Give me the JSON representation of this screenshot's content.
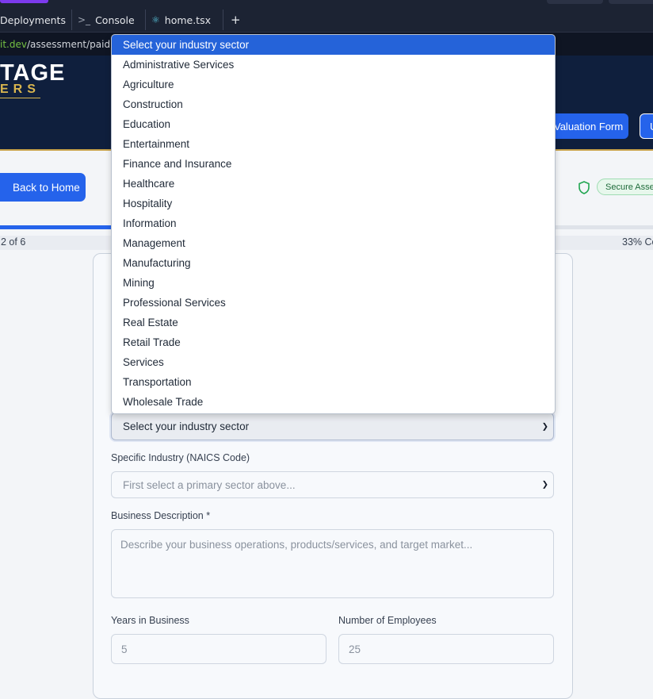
{
  "ide": {
    "tabs": [
      {
        "label": "Deployments"
      },
      {
        "glyph": ">_",
        "label": "Console"
      },
      {
        "glyph": "⚛",
        "label": "home.tsx"
      }
    ],
    "new_tab": "+",
    "url_domain": "it.dev",
    "url_path": "/assessment/paid"
  },
  "header": {
    "logo_line1": "TAGE",
    "logo_line2": "ERS",
    "valuation_button": "Valuation Form",
    "outline_button": "U"
  },
  "subheader": {
    "back_button": "Back to Home",
    "secure_badge": "Secure Assessment"
  },
  "progress": {
    "step_text": "2 of 6",
    "percent_text": "33% Co",
    "percent_value": 0.33
  },
  "form": {
    "industry_select": {
      "value": "Select your industry sector",
      "options": [
        "Select your industry sector",
        "Administrative Services",
        "Agriculture",
        "Construction",
        "Education",
        "Entertainment",
        "Finance and Insurance",
        "Healthcare",
        "Hospitality",
        "Information",
        "Management",
        "Manufacturing",
        "Mining",
        "Professional Services",
        "Real Estate",
        "Retail Trade",
        "Services",
        "Transportation",
        "Wholesale Trade"
      ]
    },
    "naics_label": "Specific Industry (NAICS Code)",
    "naics_placeholder": "First select a primary sector above...",
    "description_label": "Business Description *",
    "description_placeholder": "Describe your business operations, products/services, and target market...",
    "years_label": "Years in Business",
    "years_placeholder": "5",
    "employees_label": "Number of Employees",
    "employees_placeholder": "25"
  },
  "colors": {
    "primary": "#2563eb",
    "header_bg": "#0f1f3d",
    "gold": "#d9b64f",
    "secure_green": "#1f6b3a"
  }
}
